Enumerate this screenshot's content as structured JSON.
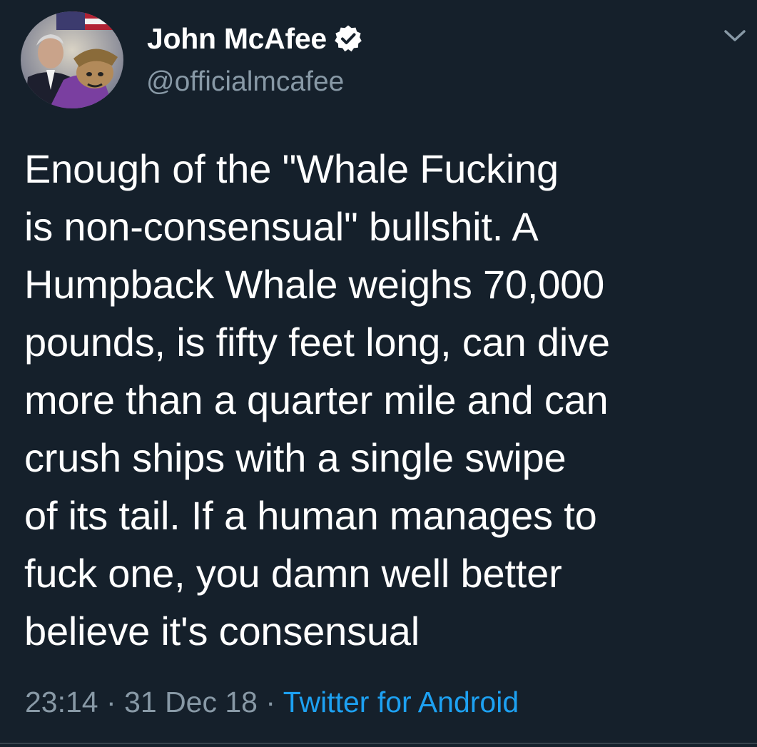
{
  "author": {
    "name": "John McAfee",
    "handle": "@officialmcafee",
    "verified": true,
    "avatar_icon": "profile-photo"
  },
  "tweet": {
    "text": "Enough of the \"Whale Fucking\nis non-consensual\" bullshit. A\nHumpback Whale weighs 70,000\npounds, is fifty feet long, can dive\nmore than a quarter mile and can\ncrush ships with a single swipe\nof its tail. If a human manages to\nfuck one, you damn well better\nbelieve it's consensual",
    "time": "23:14",
    "separator": "·",
    "date": "31 Dec 18",
    "source": "Twitter for Android"
  },
  "menu": {
    "icon": "chevron-down-icon"
  },
  "colors": {
    "background": "#15202b",
    "text": "#ffffff",
    "muted": "#8899a6",
    "accent": "#1da1f2",
    "divider": "#38444d"
  }
}
